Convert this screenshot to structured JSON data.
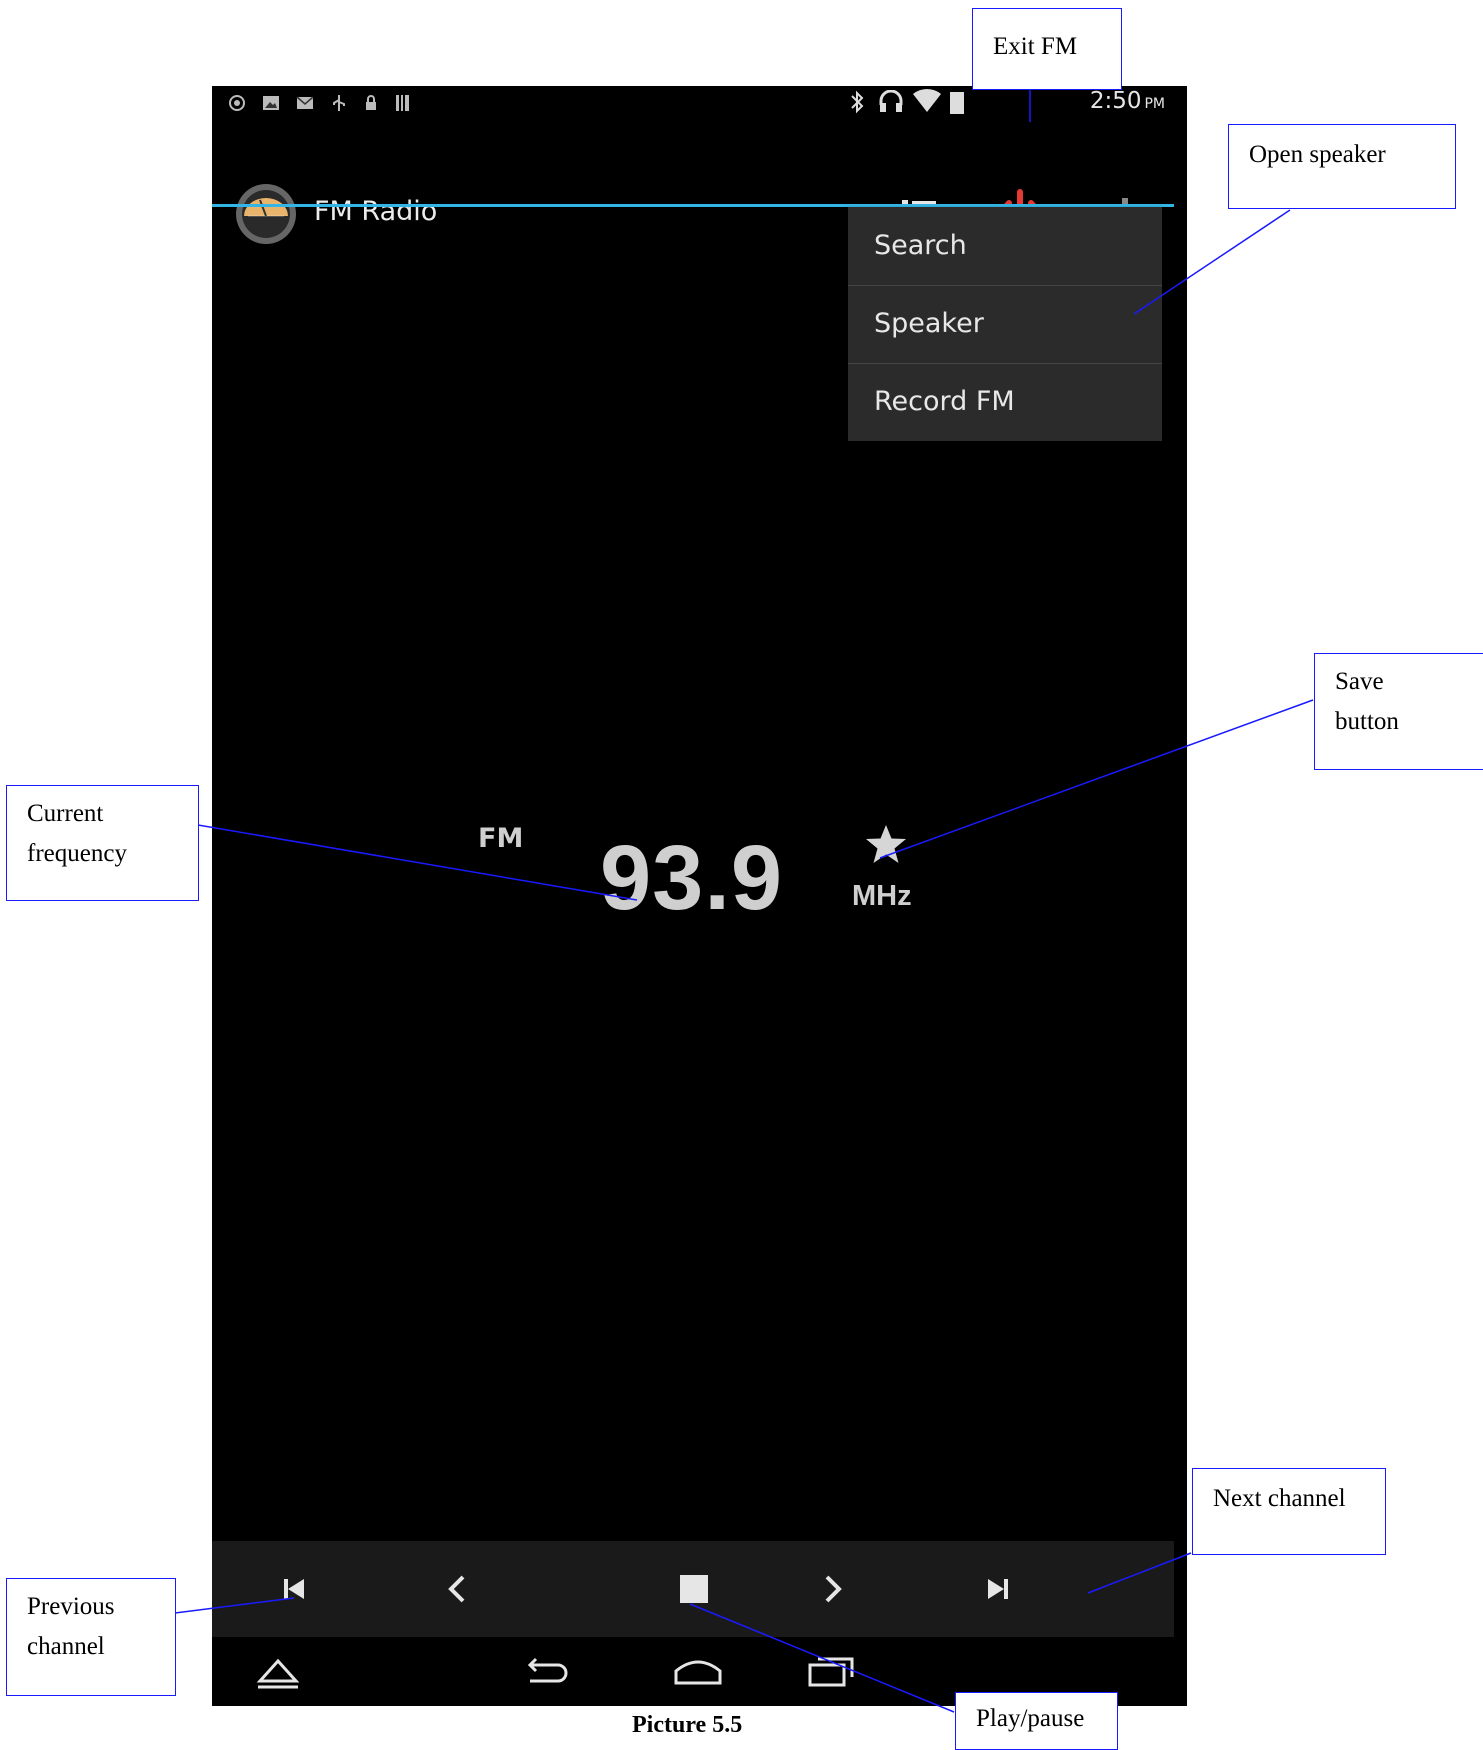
{
  "status_bar": {
    "time": "2:50",
    "ampm": "PM"
  },
  "action_bar": {
    "title": "FM Radio"
  },
  "menu": {
    "items": [
      "Search",
      "Speaker",
      "Record FM"
    ]
  },
  "station": {
    "band": "FM",
    "frequency": "93.9",
    "unit": "MHz"
  },
  "annotations": {
    "exit_fm": "Exit FM",
    "open_speaker": "Open speaker",
    "save_button_line1": "Save",
    "save_button_line2": "button",
    "current_frequency_line1": "Current",
    "current_frequency_line2": "frequency",
    "next_channel": "Next channel",
    "previous_channel_line1": "Previous",
    "previous_channel_line2": "channel",
    "play_pause": "Play/pause"
  },
  "caption": "Picture 5.5",
  "colors": {
    "accent_line": "#33b5e5",
    "power_icon": "#e53935",
    "callout_border": "#1a1aff"
  },
  "icons": [
    "radio-app-icon",
    "list-icon",
    "power-icon",
    "overflow-menu-icon",
    "star-icon",
    "skip-previous-icon",
    "chevron-left-icon",
    "stop-icon",
    "chevron-right-icon",
    "skip-next-icon",
    "nav-up-icon",
    "back-icon",
    "home-icon",
    "recents-icon"
  ]
}
